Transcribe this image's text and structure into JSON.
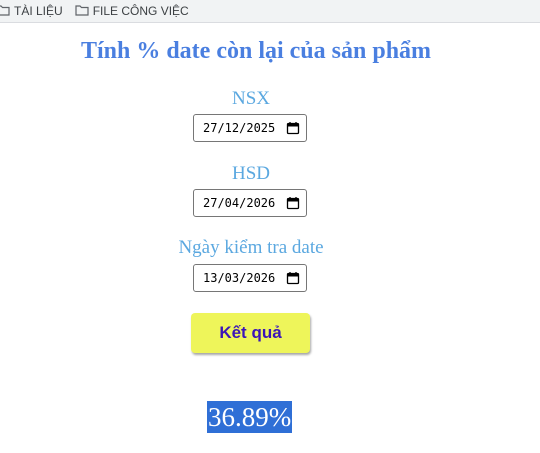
{
  "bookmarks": [
    {
      "label": "TÀI LIỆU",
      "icon": "folder-icon"
    },
    {
      "label": "FILE CÔNG VIỆC",
      "icon": "folder-icon"
    }
  ],
  "title": "Tính % date còn lại của sản phẩm",
  "fields": [
    {
      "label": "NSX",
      "value": "27/12/2025"
    },
    {
      "label": "HSD",
      "value": "27/04/2026"
    },
    {
      "label": "Ngày kiểm tra date",
      "value": "13/03/2026"
    }
  ],
  "button_label": "Kết quả",
  "result": "36.89%",
  "colors": {
    "title": "#4a7fe0",
    "label": "#5ba8e0",
    "button_bg": "#eef55a",
    "button_text": "#3b14b8",
    "result_bg": "#2f6fd6"
  }
}
